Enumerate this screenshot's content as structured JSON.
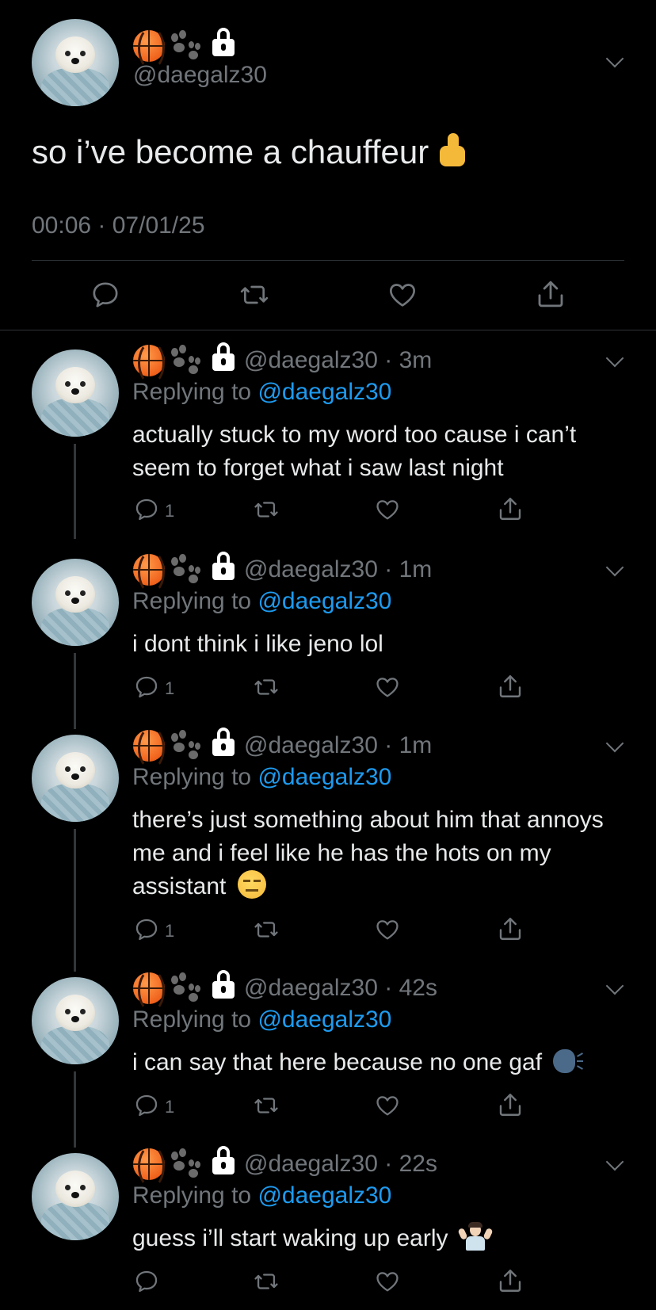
{
  "main_tweet": {
    "handle": "@daegalz30",
    "text": "so i’ve become a chauffeur",
    "text_emoji": "thumbs-up",
    "timestamp": "00:06 · 07/01/25"
  },
  "replies": [
    {
      "handle_time": "@daegalz30 · 3m",
      "replying_prefix": "Replying to ",
      "replying_mention": "@daegalz30",
      "text": "actually stuck to my word too cause i can’t seem to forget what i saw last night",
      "reply_count": "1"
    },
    {
      "handle_time": "@daegalz30 · 1m",
      "replying_prefix": "Replying to ",
      "replying_mention": "@daegalz30",
      "text": "i dont think i like jeno lol",
      "reply_count": "1"
    },
    {
      "handle_time": "@daegalz30 · 1m",
      "replying_prefix": "Replying to ",
      "replying_mention": "@daegalz30",
      "text": "there’s just something about him that annoys me and i feel like he has the hots on my assistant",
      "text_emoji": "expressionless-face",
      "reply_count": "1"
    },
    {
      "handle_time": "@daegalz30 · 42s",
      "replying_prefix": "Replying to ",
      "replying_mention": "@daegalz30",
      "text": "i can say that here because no one gaf",
      "text_emoji": "speaking-head",
      "reply_count": "1"
    },
    {
      "handle_time": "@daegalz30 · 22s",
      "replying_prefix": "Replying to ",
      "replying_mention": "@daegalz30",
      "text": "guess i’ll start waking up early",
      "text_emoji": "person-shrugging",
      "reply_count": ""
    }
  ],
  "colors": {
    "background": "#000000",
    "text": "#e7e9ea",
    "muted": "#71767b",
    "mention": "#1d9bf0",
    "divider": "#2f3336"
  }
}
